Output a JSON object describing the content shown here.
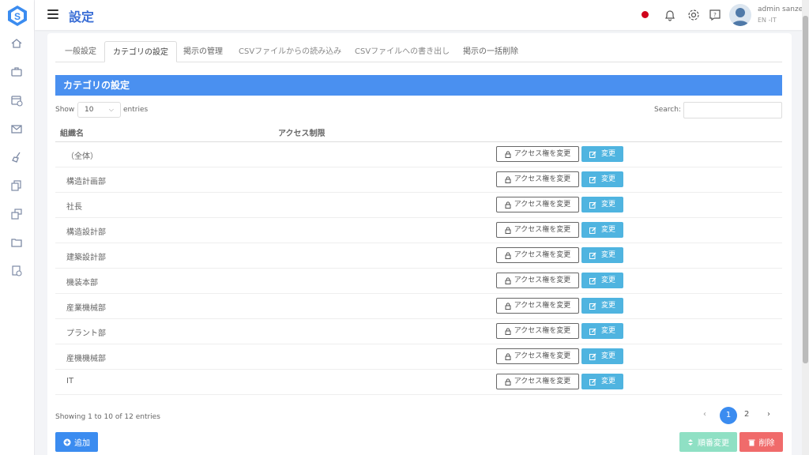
{
  "header": {
    "title": "設定",
    "user_name": "admin sanze",
    "user_lang": "EN -IT"
  },
  "sidebar": {
    "icons": [
      "home-icon",
      "briefcase-icon",
      "calendar-icon",
      "mail-icon",
      "broom-icon",
      "documents-icon",
      "stack-icon",
      "folder-icon",
      "user-settings-icon"
    ]
  },
  "tabs": [
    {
      "label": "一般設定"
    },
    {
      "label": "カテゴリの設定"
    },
    {
      "label": "掲示の管理"
    },
    {
      "label": "CSVファイルからの読み込み"
    },
    {
      "label": "CSVファイルへの書き出し"
    },
    {
      "label": "掲示の一括削除"
    }
  ],
  "section": {
    "title": "カテゴリの設定"
  },
  "table_controls": {
    "show_label": "Show",
    "page_size": "10",
    "entries_label": "entries",
    "search_label": "Search:"
  },
  "table": {
    "columns": [
      "組織名",
      "アクセス制限"
    ],
    "access_button": "アクセス権を変更",
    "edit_button": "変更",
    "rows": [
      {
        "name": "（全体）"
      },
      {
        "name": "構造計画部"
      },
      {
        "name": "社長"
      },
      {
        "name": "構造設計部"
      },
      {
        "name": "建築設計部"
      },
      {
        "name": "機装本部"
      },
      {
        "name": "産業機械部"
      },
      {
        "name": "プラント部"
      },
      {
        "name": "産機機械部"
      },
      {
        "name": "IT"
      }
    ]
  },
  "pagination": {
    "info": "Showing 1 to 10 of 12 entries",
    "prev": "‹",
    "pages": [
      "1",
      "2"
    ],
    "next": "›"
  },
  "footer_buttons": {
    "add": "追加",
    "order": "順番変更",
    "delete": "削除"
  },
  "colors": {
    "accent": "#3b8cf0",
    "header_bar": "#4a90f0",
    "edit": "#4fb4e0",
    "order": "#8fe0c4",
    "delete": "#f06b6b"
  }
}
